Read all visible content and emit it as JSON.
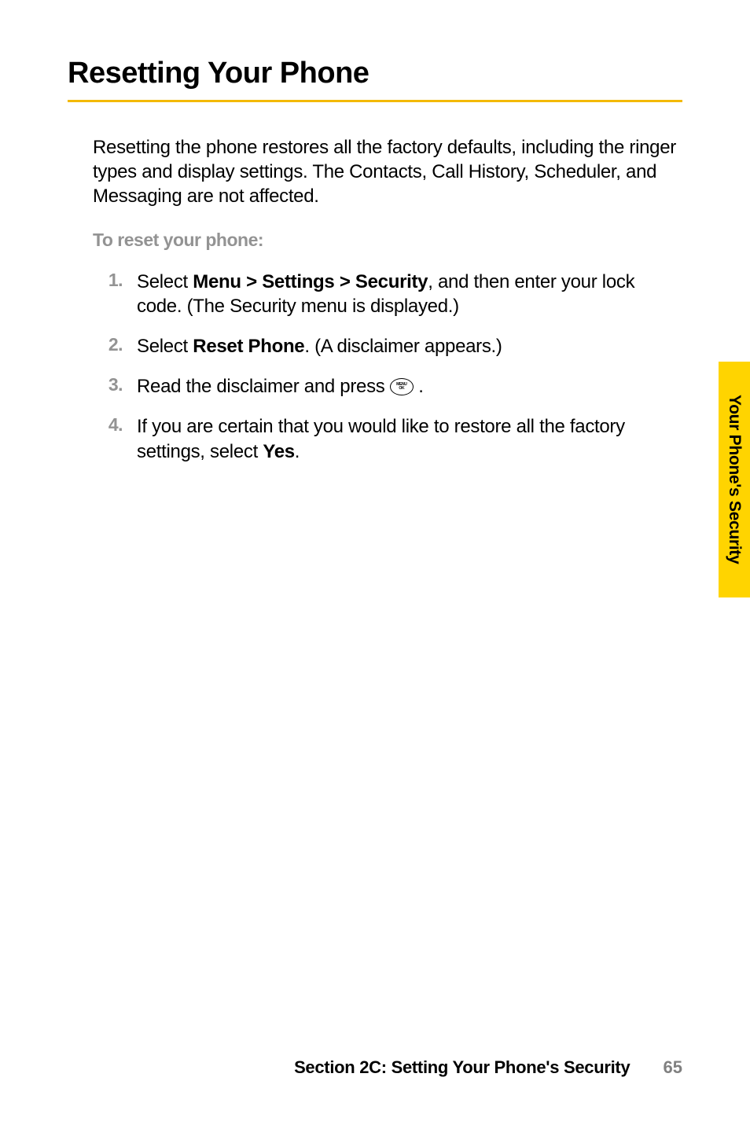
{
  "heading": "Resetting Your Phone",
  "intro": "Resetting the phone restores all the factory defaults, including the ringer types and display settings. The Contacts, Call History, Scheduler, and Messaging are not affected.",
  "sub_heading": "To reset your phone:",
  "steps": [
    {
      "num": "1.",
      "pre": "Select ",
      "bold1": "Menu > Settings > Security",
      "mid": ", and then enter your lock code. (The Security menu is displayed.)",
      "bold2": "",
      "post": "",
      "has_icon": false
    },
    {
      "num": "2.",
      "pre": "Select ",
      "bold1": "Reset Phone",
      "mid": ". (A disclaimer appears.)",
      "bold2": "",
      "post": "",
      "has_icon": false
    },
    {
      "num": "3.",
      "pre": "Read the disclaimer and press ",
      "bold1": "",
      "mid": "",
      "bold2": "",
      "post": " .",
      "has_icon": true
    },
    {
      "num": "4.",
      "pre": "If you are certain that you would like to restore all the factory settings, select ",
      "bold1": "Yes",
      "mid": ".",
      "bold2": "",
      "post": "",
      "has_icon": false
    }
  ],
  "icon": {
    "top": "MENU",
    "bottom": "OK"
  },
  "side_tab": "Your Phone's Security",
  "footer": {
    "section": "Section 2C: Setting Your Phone's Security",
    "page": "65"
  }
}
